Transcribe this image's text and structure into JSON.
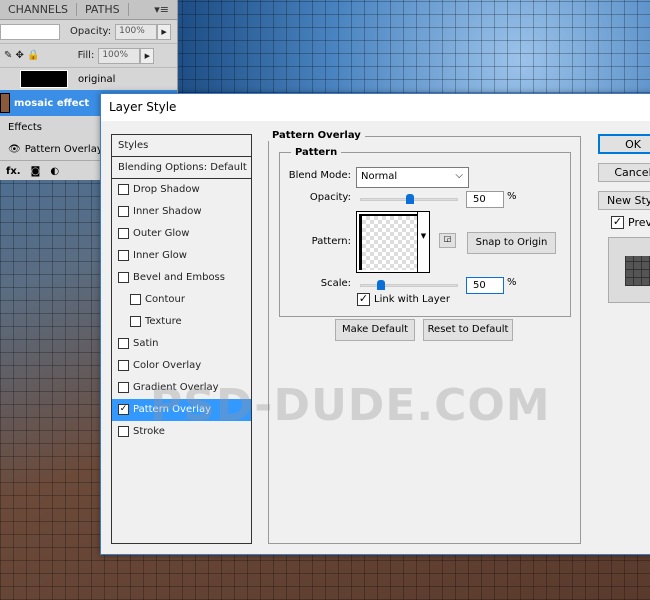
{
  "layers_panel": {
    "tabs": [
      "CHANNELS",
      "PATHS"
    ],
    "opacity_label": "Opacity:",
    "opacity_value": "100%",
    "fill_label": "Fill:",
    "fill_value": "100%",
    "layers": [
      {
        "name": "original"
      },
      {
        "name": "mosaic effect",
        "selected": true
      }
    ],
    "effects_label": "Effects",
    "effect_item": "Pattern Overlay"
  },
  "dialog": {
    "title": "Layer Style",
    "styles": [
      {
        "label": "Styles",
        "header": true
      },
      {
        "label": "Blending Options: Default",
        "header": true
      },
      {
        "label": "Drop Shadow",
        "checked": false
      },
      {
        "label": "Inner Shadow",
        "checked": false
      },
      {
        "label": "Outer Glow",
        "checked": false
      },
      {
        "label": "Inner Glow",
        "checked": false
      },
      {
        "label": "Bevel and Emboss",
        "checked": false
      },
      {
        "label": "Contour",
        "checked": false,
        "indent": true
      },
      {
        "label": "Texture",
        "checked": false,
        "indent": true
      },
      {
        "label": "Satin",
        "checked": false
      },
      {
        "label": "Color Overlay",
        "checked": false
      },
      {
        "label": "Gradient Overlay",
        "checked": false
      },
      {
        "label": "Pattern Overlay",
        "checked": true,
        "selected": true
      },
      {
        "label": "Stroke",
        "checked": false
      }
    ],
    "section_title": "Pattern Overlay",
    "group_title": "Pattern",
    "blend_mode_label": "Blend Mode:",
    "blend_mode": "Normal",
    "opacity_label": "Opacity:",
    "opacity": "50",
    "opacity_pct": 50,
    "percent": "%",
    "pattern_label": "Pattern:",
    "snap_label": "Snap to Origin",
    "scale_label": "Scale:",
    "scale": "50",
    "scale_pct": 20,
    "link_label": "Link with Layer",
    "link_checked": true,
    "make_default": "Make Default",
    "reset_default": "Reset to Default",
    "ok": "OK",
    "cancel": "Cancel",
    "new_style": "New Style...",
    "preview_label": "Preview",
    "preview_checked": true
  },
  "watermark": "PSD-DUDE.COM"
}
